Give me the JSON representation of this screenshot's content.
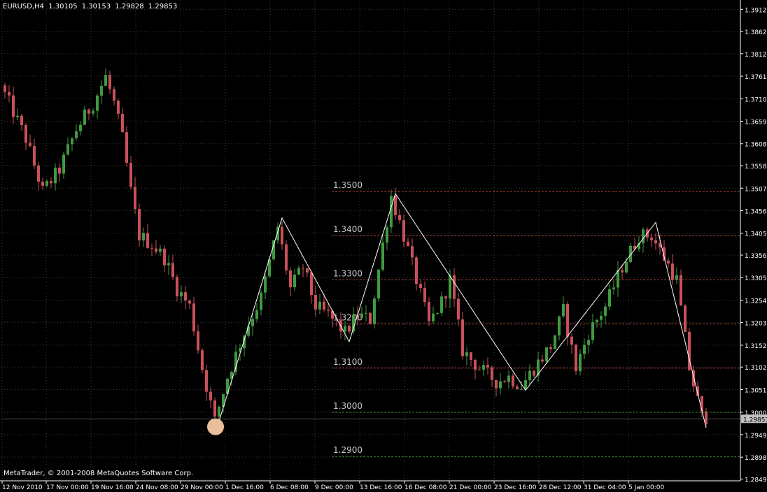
{
  "header": {
    "symbol": "EURUSD,H4",
    "open": "1.30105",
    "high": "1.30153",
    "low": "1.29828",
    "close": "1.29853"
  },
  "copyright": "MetaTrader, © 2001-2008 MetaQuotes Software Corp.",
  "colors": {
    "background": "#000000",
    "axis": "#ffffff",
    "grid": "#3a3a3a",
    "bull": "#3f9a3f",
    "bear": "#c9505a",
    "level_red": "#b0443c",
    "level_green": "#2e8b2e",
    "zigzag": "#ffffff",
    "price_tag": "#c0c0c0",
    "marker": "#f7c7a3"
  },
  "chart_data": {
    "type": "candlestick",
    "symbol": "EURUSD",
    "timeframe": "H4",
    "ylim": [
      1.2849,
      1.3925
    ],
    "y_ticks": [
      "1.39125",
      "1.38620",
      "1.38120",
      "1.37610",
      "1.37100",
      "1.36590",
      "1.36080",
      "1.35585",
      "1.35075",
      "1.34565",
      "1.34055",
      "1.33560",
      "1.33050",
      "1.32540",
      "1.32035",
      "1.31520",
      "1.31025",
      "1.30515",
      "1.30000",
      "1.29495",
      "1.28985",
      "1.28490"
    ],
    "x_ticks": [
      "12 Nov 2010",
      "17 Nov 00:00",
      "19 Nov 16:00",
      "24 Nov 08:00",
      "29 Nov 00:00",
      "1 Dec 16:00",
      "6 Dec 08:00",
      "9 Dec 00:00",
      "13 Dec 16:00",
      "16 Dec 08:00",
      "21 Dec 00:00",
      "23 Dec 16:00",
      "28 Dec 12:00",
      "31 Dec 04:00",
      "5 Jan 00:00"
    ],
    "current_price": "1.29853",
    "levels": [
      {
        "label": "1.3500",
        "value": 1.35,
        "kind": "resistance"
      },
      {
        "label": "1.3400",
        "value": 1.34,
        "kind": "resistance"
      },
      {
        "label": "1.3300",
        "value": 1.33,
        "kind": "resistance"
      },
      {
        "label": "1.3200",
        "value": 1.32,
        "kind": "resistance"
      },
      {
        "label": "1.3100",
        "value": 1.31,
        "kind": "resistance"
      },
      {
        "label": "1.3000",
        "value": 1.3,
        "kind": "support"
      },
      {
        "label": "1.2900",
        "value": 1.29,
        "kind": "support"
      }
    ],
    "zigzag": [
      {
        "bar": 51,
        "price": 1.298
      },
      {
        "bar": 66,
        "price": 1.344
      },
      {
        "bar": 82,
        "price": 1.316
      },
      {
        "bar": 93,
        "price": 1.3495
      },
      {
        "bar": 124,
        "price": 1.305
      },
      {
        "bar": 155,
        "price": 1.343
      },
      {
        "bar": 167,
        "price": 1.2965
      }
    ],
    "marker": {
      "bar": 51,
      "price": 1.298
    },
    "anchors": [
      [
        0,
        1.374
      ],
      [
        3,
        1.368
      ],
      [
        6,
        1.362
      ],
      [
        10,
        1.35
      ],
      [
        14,
        1.355
      ],
      [
        18,
        1.364
      ],
      [
        22,
        1.37
      ],
      [
        25,
        1.376
      ],
      [
        27,
        1.37
      ],
      [
        29,
        1.362
      ],
      [
        31,
        1.35
      ],
      [
        33,
        1.34
      ],
      [
        36,
        1.338
      ],
      [
        39,
        1.335
      ],
      [
        42,
        1.328
      ],
      [
        45,
        1.324
      ],
      [
        48,
        1.31
      ],
      [
        51,
        1.298
      ],
      [
        54,
        1.308
      ],
      [
        58,
        1.318
      ],
      [
        62,
        1.326
      ],
      [
        66,
        1.342
      ],
      [
        69,
        1.328
      ],
      [
        72,
        1.333
      ],
      [
        75,
        1.324
      ],
      [
        78,
        1.322
      ],
      [
        82,
        1.318
      ],
      [
        85,
        1.322
      ],
      [
        88,
        1.321
      ],
      [
        91,
        1.338
      ],
      [
        93,
        1.349
      ],
      [
        96,
        1.34
      ],
      [
        99,
        1.33
      ],
      [
        102,
        1.32
      ],
      [
        105,
        1.325
      ],
      [
        107,
        1.33
      ],
      [
        110,
        1.314
      ],
      [
        114,
        1.31
      ],
      [
        118,
        1.307
      ],
      [
        121,
        1.308
      ],
      [
        124,
        1.306
      ],
      [
        127,
        1.31
      ],
      [
        131,
        1.315
      ],
      [
        134,
        1.323
      ],
      [
        137,
        1.31
      ],
      [
        140,
        1.318
      ],
      [
        144,
        1.324
      ],
      [
        148,
        1.333
      ],
      [
        152,
        1.34
      ],
      [
        155,
        1.34
      ],
      [
        158,
        1.335
      ],
      [
        161,
        1.33
      ],
      [
        164,
        1.31
      ],
      [
        167,
        1.299
      ]
    ]
  }
}
